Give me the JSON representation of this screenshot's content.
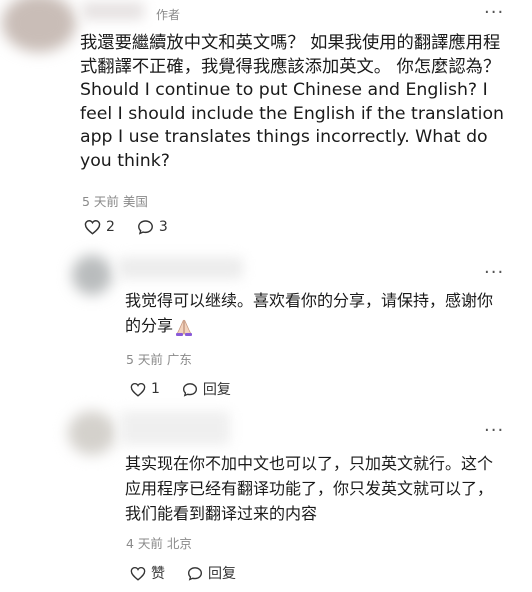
{
  "author_tag": "作者",
  "comments": [
    {
      "text": "我還要繼續放中文和英文嗎？ 如果我使用的翻譯應用程式翻譯不正確，我覺得我應該添加英文。 你怎麼認為？ Should I continue to put Chinese and English? I feel I should include the English if the translation app I use translates things incorrectly. What do you think?",
      "time": "5 天前",
      "location": "美国",
      "likes": "2",
      "replies": "3"
    },
    {
      "text": "我觉得可以继续。喜欢看你的分享，请保持，感谢你的分享",
      "time": "5 天前",
      "location": "广东",
      "likes": "1",
      "reply_label": "回复"
    },
    {
      "text": "其实现在你不加中文也可以了，只加英文就行。这个应用程序已经有翻译功能了，你只发英文就可以了，我们能看到翻译过来的内容",
      "time": "4 天前",
      "location": "北京",
      "like_label": "赞",
      "reply_label": "回复"
    }
  ],
  "icons": {
    "like": "heart-icon",
    "reply": "speech-bubble-icon",
    "more": "more-dots-icon",
    "emoji": "praying-hands-emoji"
  }
}
